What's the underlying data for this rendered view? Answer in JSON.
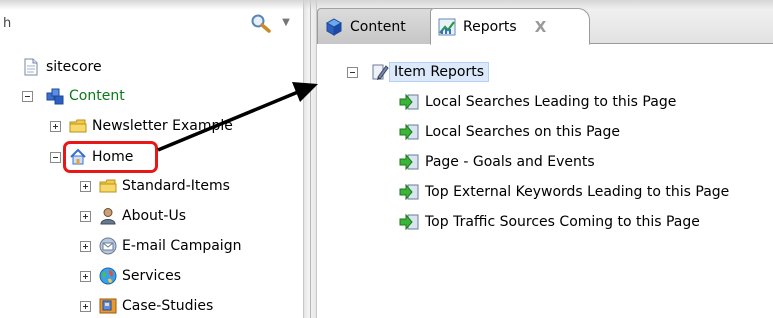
{
  "search": {
    "value": "h",
    "icon": "search-icon",
    "dropdown_icon": "chevron-down-icon"
  },
  "content_tree": {
    "root": {
      "label": "sitecore",
      "icon": "document-icon"
    },
    "content": {
      "label": "Content",
      "icon": "content-node-icon",
      "color": "#0a7a16"
    },
    "items": [
      {
        "label": "Newsletter Example",
        "icon": "folder-icon"
      },
      {
        "label": "Home",
        "icon": "home-icon",
        "highlighted": true
      },
      {
        "label": "Standard-Items",
        "icon": "folder-icon"
      },
      {
        "label": "About-Us",
        "icon": "person-icon"
      },
      {
        "label": "E-mail Campaign",
        "icon": "email-icon"
      },
      {
        "label": "Services",
        "icon": "globe-icon"
      },
      {
        "label": "Case-Studies",
        "icon": "case-study-icon"
      }
    ]
  },
  "tabs": [
    {
      "label": "Content",
      "icon": "cube-icon",
      "active": false
    },
    {
      "label": "Reports",
      "icon": "reports-chart-icon",
      "active": true,
      "close_label": "X"
    }
  ],
  "reports": {
    "group": {
      "label": "Item Reports",
      "icon": "report-pen-icon"
    },
    "items": [
      {
        "label": "Local Searches Leading to this Page",
        "icon": "green-arrow-report-icon"
      },
      {
        "label": "Local Searches on this Page",
        "icon": "green-arrow-report-icon"
      },
      {
        "label": "Page - Goals and Events",
        "icon": "green-arrow-report-icon"
      },
      {
        "label": "Top External Keywords Leading to this Page",
        "icon": "green-arrow-report-icon"
      },
      {
        "label": "Top Traffic Sources Coming to this Page",
        "icon": "green-arrow-report-icon"
      }
    ]
  },
  "colors": {
    "highlight": "#e81818",
    "content_green": "#0a7a16",
    "selection": "#dbe9fb"
  }
}
